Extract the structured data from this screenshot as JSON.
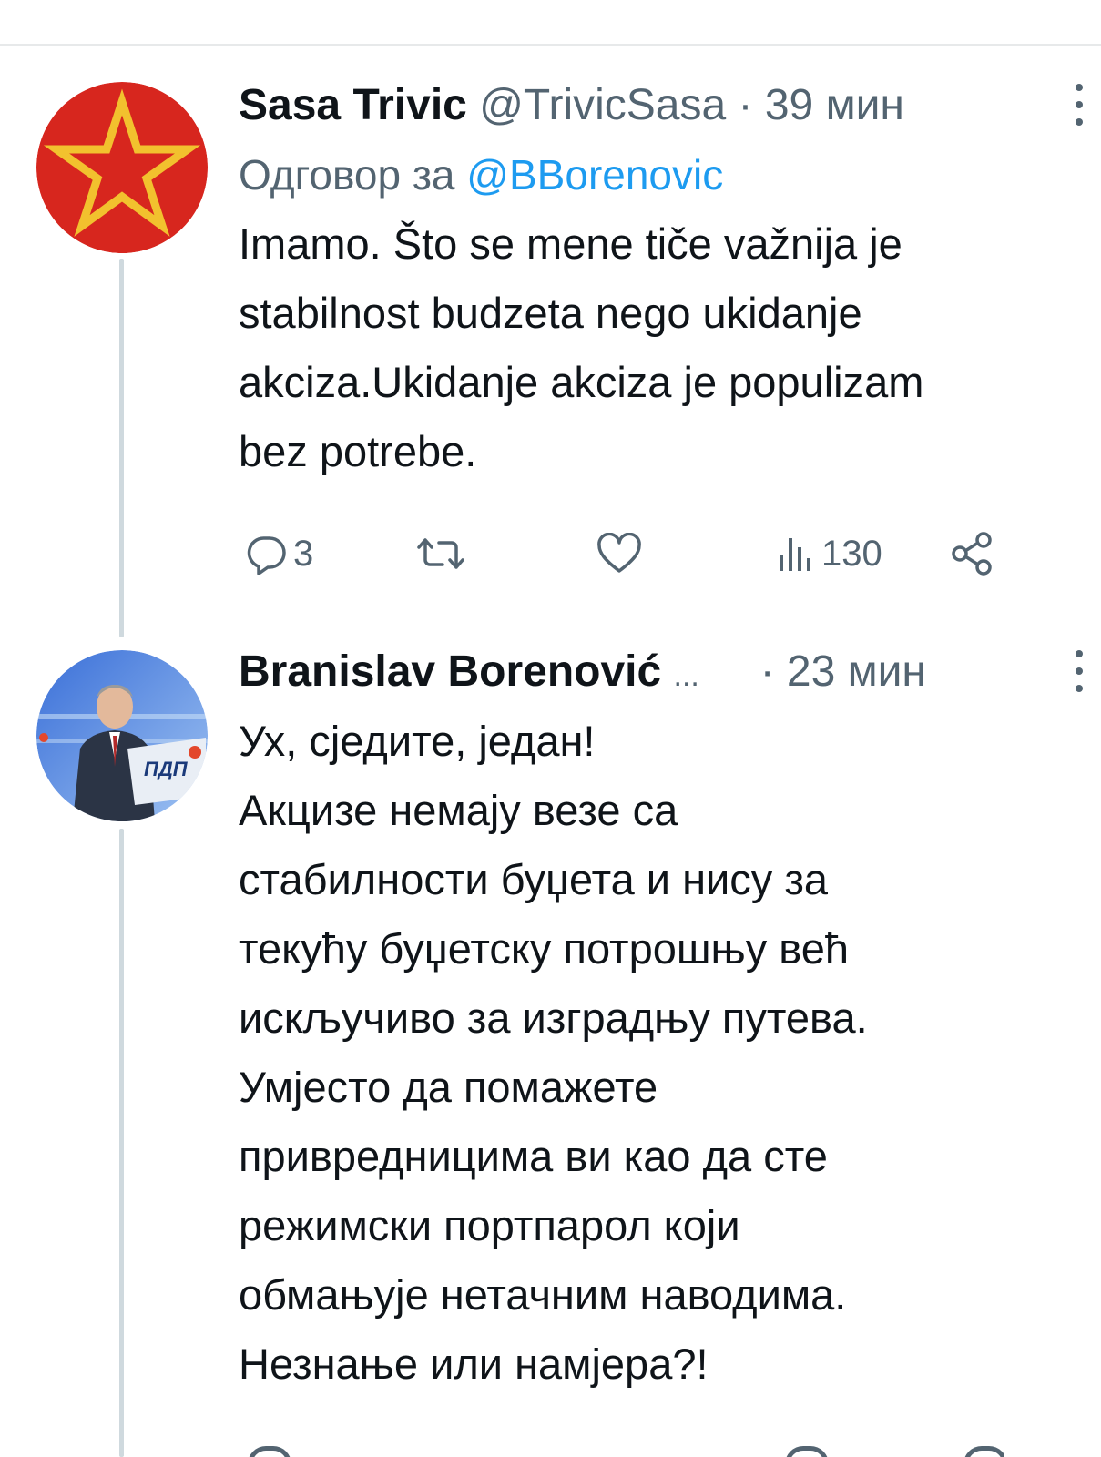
{
  "tweets": [
    {
      "author_name": "Sasa Trivic",
      "handle": "@TrivicSasa",
      "separator": "·",
      "time": "39 мин",
      "reply_prefix": "Одговор за",
      "reply_mention": "@BBorenovic",
      "text_lines": [
        "Imamo. Što se mene tiče važnija je",
        "stabilnost budzeta nego ukidanje",
        "akciza.Ukidanje akciza je populizam",
        "bez potrebe."
      ],
      "replies": "3",
      "views": "130",
      "avatar": "red-star-icon"
    },
    {
      "author_name": "Branislav Borenović",
      "name_ellipsis": "...",
      "separator": "·",
      "time": "23 мин",
      "text_lines": [
        "Ух, сједите, један!",
        "Акцизе немају везе са",
        "стабилности буџета и нису за",
        "текућу буџетску потрошњу већ",
        "искључиво за изградњу путева.",
        "Умјесто да помажете",
        "привредницима ви као да сте",
        "режимски портпарол који",
        "обмањује нетачним наводима.",
        "Незнање или намјера?!"
      ],
      "avatar": "speaker-photo"
    }
  ],
  "colors": {
    "text": "#0f1419",
    "muted": "#536471",
    "link": "#1d9bf0",
    "divider": "#e7e9ea",
    "thread_line": "#cfd9de",
    "avatar_red": "#d7261e",
    "star_yellow": "#f2c12e"
  },
  "icons": [
    "reply-icon",
    "retweet-icon",
    "like-icon",
    "views-icon",
    "share-icon",
    "more-icon"
  ]
}
